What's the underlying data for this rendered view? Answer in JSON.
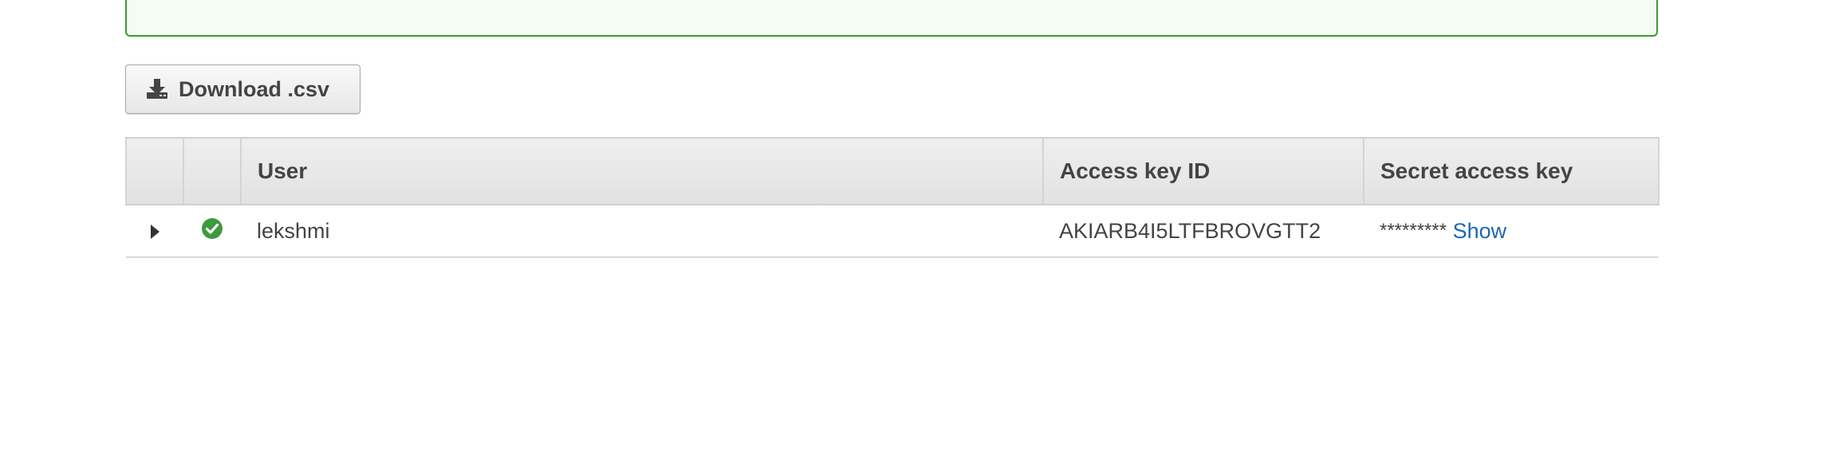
{
  "download_button": {
    "label": "Download .csv",
    "icon": "download-icon"
  },
  "table": {
    "columns": [
      "",
      "",
      "User",
      "Access key ID",
      "Secret access key"
    ],
    "rows": [
      {
        "status_icon": "check-circle-icon",
        "user": "lekshmi",
        "access_key_id": "AKIARB4I5LTFBROVGTT2",
        "secret_mask": "*********",
        "show_label": "Show"
      }
    ]
  },
  "colors": {
    "success_border": "#3b9b2f",
    "success_background": "#f5fcf4",
    "link": "#1f66b3",
    "status_ok": "#3c9a3c"
  }
}
